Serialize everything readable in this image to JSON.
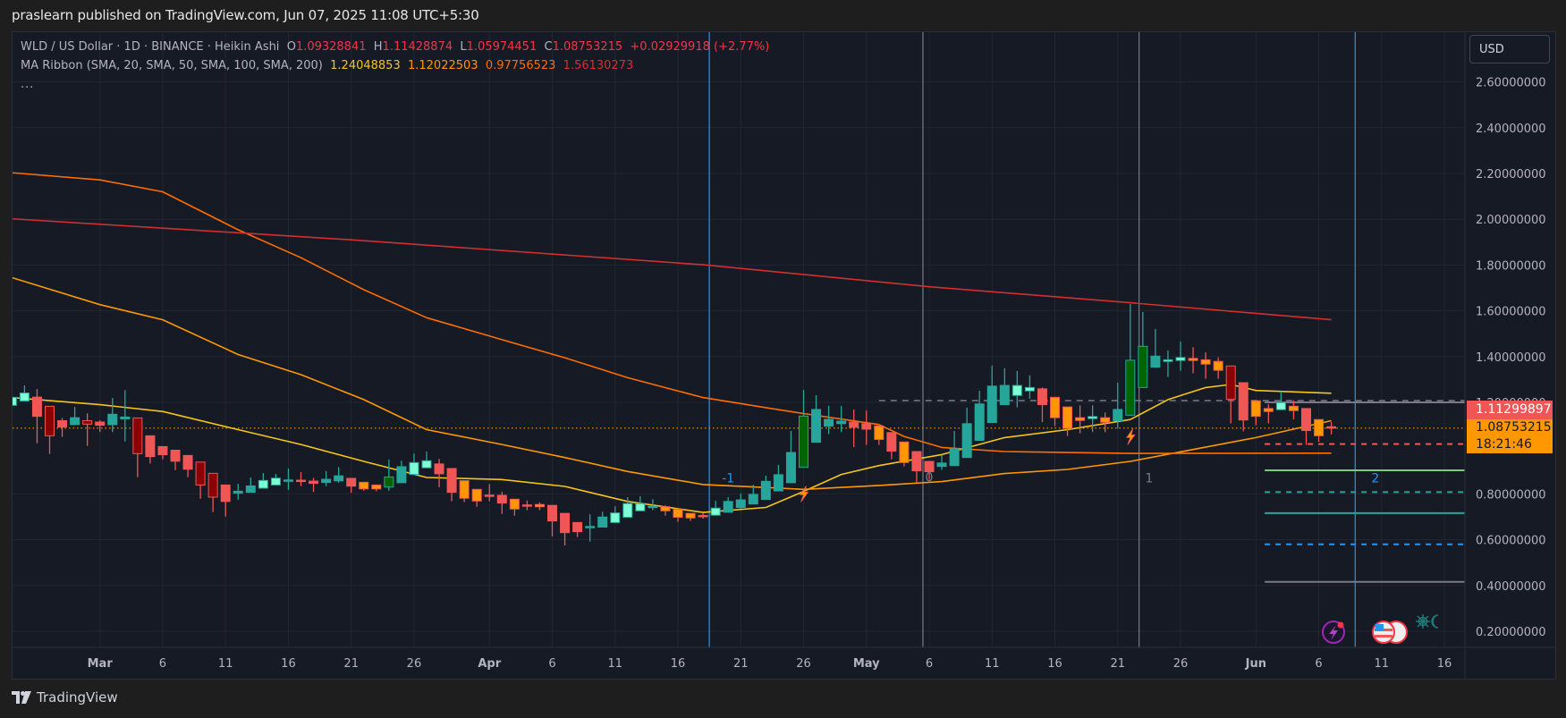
{
  "publish_line": "praslearn published on TradingView.com, Jun 07, 2025 11:08 UTC+5:30",
  "legend": {
    "symbol": "WLD / US Dollar · 1D · BINANCE · Heikin Ashi",
    "o_label": "O",
    "o": "1.09328841",
    "h_label": "H",
    "h": "1.11428874",
    "l_label": "L",
    "l": "1.05974451",
    "c_label": "C",
    "c": "1.08753215",
    "change": "+0.02929918 (+2.77%)",
    "ma_title": "MA Ribbon (SMA, 20, SMA, 50, SMA, 100, SMA, 200)",
    "ma20": "1.24048853",
    "ma50": "1.12022503",
    "ma100": "0.97756523",
    "ma200": "1.56130273",
    "more": "..."
  },
  "currency_button": "USD",
  "badges": {
    "level_price": "1.11299897",
    "last_price": "1.08753215",
    "countdown": "18:21:46"
  },
  "colors": {
    "bg": "#161a25",
    "grid": "#232632",
    "teal": "#26a69a",
    "mint": "#7fffd4",
    "green": "#006400",
    "red": "#f05656",
    "darkred": "#8b0000",
    "orange": "#ff9800",
    "ma20": "#f5c518",
    "ma50": "#ff9800",
    "ma100": "#ff6d00",
    "ma200": "#d32f2f"
  },
  "footer_brand": "TradingView",
  "chart_data": {
    "type": "candlestick",
    "style": "Heikin Ashi",
    "x_unit": "days since Mar 1, 2025",
    "ylim": [
      0.1,
      2.75
    ],
    "price_ticks": [
      "2.60000000",
      "2.40000000",
      "2.20000000",
      "2.00000000",
      "1.80000000",
      "1.60000000",
      "1.40000000",
      "1.20000000",
      "0.80000000",
      "0.60000000",
      "0.40000000",
      "0.20000000"
    ],
    "price_tick_values": [
      2.6,
      2.4,
      2.2,
      2.0,
      1.8,
      1.6,
      1.4,
      1.2,
      0.8,
      0.6,
      0.4,
      0.2
    ],
    "time_ticks": [
      {
        "label": "Mar",
        "day": 0,
        "bold": true
      },
      {
        "label": "6",
        "day": 5
      },
      {
        "label": "11",
        "day": 10
      },
      {
        "label": "16",
        "day": 15
      },
      {
        "label": "21",
        "day": 20
      },
      {
        "label": "26",
        "day": 25
      },
      {
        "label": "Apr",
        "day": 31,
        "bold": true
      },
      {
        "label": "6",
        "day": 36
      },
      {
        "label": "11",
        "day": 41
      },
      {
        "label": "16",
        "day": 46
      },
      {
        "label": "21",
        "day": 51
      },
      {
        "label": "26",
        "day": 56
      },
      {
        "label": "May",
        "day": 61,
        "bold": true
      },
      {
        "label": "6",
        "day": 66
      },
      {
        "label": "11",
        "day": 71
      },
      {
        "label": "16",
        "day": 76
      },
      {
        "label": "21",
        "day": 81
      },
      {
        "label": "26",
        "day": 86
      },
      {
        "label": "Jun",
        "day": 92,
        "bold": true
      },
      {
        "label": "6",
        "day": 97
      },
      {
        "label": "11",
        "day": 102
      },
      {
        "label": "16",
        "day": 107
      }
    ],
    "first_day": -7,
    "candles_ohlc_color": [
      [
        1.187,
        1.284,
        1.17,
        1.222,
        "m"
      ],
      [
        1.206,
        1.274,
        1.206,
        1.241,
        "m"
      ],
      [
        1.223,
        1.258,
        1.021,
        1.139,
        "r"
      ],
      [
        1.183,
        1.183,
        0.975,
        1.054,
        "d"
      ],
      [
        1.12,
        1.132,
        1.049,
        1.092,
        "r"
      ],
      [
        1.103,
        1.18,
        1.1,
        1.133,
        "t"
      ],
      [
        1.12,
        1.152,
        1.01,
        1.105,
        "d"
      ],
      [
        1.114,
        1.122,
        1.07,
        1.1,
        "r"
      ],
      [
        1.103,
        1.219,
        1.07,
        1.148,
        "t"
      ],
      [
        1.128,
        1.254,
        1.029,
        1.136,
        "t"
      ],
      [
        1.132,
        1.132,
        0.873,
        0.976,
        "d"
      ],
      [
        1.054,
        1.054,
        0.933,
        0.963,
        "r"
      ],
      [
        1.007,
        1.007,
        0.951,
        0.971,
        "r"
      ],
      [
        0.991,
        0.991,
        0.904,
        0.943,
        "r"
      ],
      [
        0.968,
        0.968,
        0.873,
        0.908,
        "r"
      ],
      [
        0.939,
        0.939,
        0.779,
        0.839,
        "d"
      ],
      [
        0.89,
        0.89,
        0.721,
        0.786,
        "d"
      ],
      [
        0.839,
        0.839,
        0.701,
        0.767,
        "r"
      ],
      [
        0.803,
        0.844,
        0.775,
        0.812,
        "t"
      ],
      [
        0.807,
        0.872,
        0.807,
        0.835,
        "t"
      ],
      [
        0.825,
        0.891,
        0.825,
        0.859,
        "m"
      ],
      [
        0.839,
        0.887,
        0.839,
        0.869,
        "m"
      ],
      [
        0.858,
        0.911,
        0.818,
        0.861,
        "t"
      ],
      [
        0.86,
        0.895,
        0.834,
        0.857,
        "r"
      ],
      [
        0.856,
        0.87,
        0.809,
        0.846,
        "r"
      ],
      [
        0.85,
        0.9,
        0.834,
        0.864,
        "t"
      ],
      [
        0.857,
        0.917,
        0.849,
        0.879,
        "t"
      ],
      [
        0.868,
        0.87,
        0.805,
        0.834,
        "r"
      ],
      [
        0.851,
        0.851,
        0.814,
        0.822,
        "o"
      ],
      [
        0.839,
        0.839,
        0.812,
        0.822,
        "o"
      ],
      [
        0.83,
        0.95,
        0.814,
        0.874,
        "g"
      ],
      [
        0.849,
        0.945,
        0.849,
        0.919,
        "t"
      ],
      [
        0.885,
        0.976,
        0.885,
        0.937,
        "m"
      ],
      [
        0.914,
        0.985,
        0.914,
        0.945,
        "m"
      ],
      [
        0.931,
        0.953,
        0.829,
        0.888,
        "r"
      ],
      [
        0.911,
        0.911,
        0.768,
        0.807,
        "r"
      ],
      [
        0.858,
        0.858,
        0.764,
        0.781,
        "o"
      ],
      [
        0.82,
        0.82,
        0.744,
        0.769,
        "o"
      ],
      [
        0.795,
        0.843,
        0.768,
        0.793,
        "r"
      ],
      [
        0.794,
        0.81,
        0.713,
        0.76,
        "r"
      ],
      [
        0.777,
        0.777,
        0.705,
        0.734,
        "o"
      ],
      [
        0.752,
        0.771,
        0.729,
        0.749,
        "r"
      ],
      [
        0.754,
        0.763,
        0.729,
        0.744,
        "o"
      ],
      [
        0.75,
        0.75,
        0.614,
        0.682,
        "r"
      ],
      [
        0.715,
        0.715,
        0.575,
        0.631,
        "r"
      ],
      [
        0.675,
        0.675,
        0.612,
        0.635,
        "r"
      ],
      [
        0.655,
        0.711,
        0.592,
        0.658,
        "t"
      ],
      [
        0.655,
        0.722,
        0.655,
        0.699,
        "t"
      ],
      [
        0.675,
        0.746,
        0.675,
        0.717,
        "m"
      ],
      [
        0.698,
        0.786,
        0.698,
        0.758,
        "m"
      ],
      [
        0.726,
        0.79,
        0.726,
        0.758,
        "m"
      ],
      [
        0.745,
        0.777,
        0.729,
        0.746,
        "t"
      ],
      [
        0.744,
        0.75,
        0.705,
        0.726,
        "o"
      ],
      [
        0.734,
        0.734,
        0.678,
        0.698,
        "o"
      ],
      [
        0.715,
        0.715,
        0.682,
        0.695,
        "o"
      ],
      [
        0.706,
        0.718,
        0.692,
        0.705,
        "r"
      ],
      [
        0.707,
        0.77,
        0.707,
        0.738,
        "m"
      ],
      [
        0.72,
        0.786,
        0.72,
        0.767,
        "t"
      ],
      [
        0.741,
        0.802,
        0.735,
        0.774,
        "t"
      ],
      [
        0.756,
        0.84,
        0.756,
        0.798,
        "t"
      ],
      [
        0.776,
        0.88,
        0.776,
        0.855,
        "t"
      ],
      [
        0.813,
        0.927,
        0.813,
        0.884,
        "t"
      ],
      [
        0.849,
        1.075,
        0.849,
        0.981,
        "t"
      ],
      [
        0.916,
        1.255,
        0.916,
        1.14,
        "g"
      ],
      [
        1.026,
        1.232,
        1.026,
        1.169,
        "t"
      ],
      [
        1.096,
        1.185,
        1.061,
        1.126,
        "t"
      ],
      [
        1.107,
        1.185,
        1.07,
        1.118,
        "t"
      ],
      [
        1.114,
        1.169,
        1.005,
        1.091,
        "r"
      ],
      [
        1.107,
        1.165,
        1.014,
        1.083,
        "r"
      ],
      [
        1.097,
        1.097,
        1.014,
        1.038,
        "o"
      ],
      [
        1.068,
        1.068,
        0.952,
        0.987,
        "r"
      ],
      [
        1.027,
        1.027,
        0.92,
        0.937,
        "o"
      ],
      [
        0.985,
        0.985,
        0.849,
        0.901,
        "r"
      ],
      [
        0.942,
        0.942,
        0.862,
        0.897,
        "r"
      ],
      [
        0.92,
        0.97,
        0.905,
        0.935,
        "t"
      ],
      [
        0.924,
        1.075,
        0.924,
        0.997,
        "t"
      ],
      [
        0.959,
        1.177,
        0.959,
        1.107,
        "t"
      ],
      [
        1.034,
        1.251,
        1.034,
        1.193,
        "t"
      ],
      [
        1.112,
        1.36,
        1.112,
        1.271,
        "t"
      ],
      [
        1.19,
        1.349,
        1.19,
        1.274,
        "t"
      ],
      [
        1.23,
        1.337,
        1.178,
        1.274,
        "m"
      ],
      [
        1.25,
        1.318,
        1.216,
        1.265,
        "m"
      ],
      [
        1.259,
        1.265,
        1.114,
        1.19,
        "r"
      ],
      [
        1.222,
        1.222,
        1.096,
        1.133,
        "o"
      ],
      [
        1.18,
        1.18,
        1.053,
        1.086,
        "o"
      ],
      [
        1.133,
        1.187,
        1.065,
        1.121,
        "o"
      ],
      [
        1.129,
        1.187,
        1.07,
        1.138,
        "m"
      ],
      [
        1.133,
        1.156,
        1.07,
        1.113,
        "o"
      ],
      [
        1.12,
        1.286,
        1.086,
        1.169,
        "t"
      ],
      [
        1.144,
        1.63,
        1.144,
        1.384,
        "g"
      ],
      [
        1.265,
        1.595,
        1.265,
        1.445,
        "g"
      ],
      [
        1.354,
        1.521,
        1.35,
        1.402,
        "t"
      ],
      [
        1.379,
        1.427,
        1.311,
        1.386,
        "m"
      ],
      [
        1.383,
        1.466,
        1.338,
        1.396,
        "m"
      ],
      [
        1.392,
        1.441,
        1.327,
        1.383,
        "o"
      ],
      [
        1.386,
        1.418,
        1.303,
        1.367,
        "o"
      ],
      [
        1.379,
        1.396,
        1.303,
        1.34,
        "o"
      ],
      [
        1.359,
        1.359,
        1.108,
        1.213,
        "d"
      ],
      [
        1.286,
        1.286,
        1.073,
        1.123,
        "r"
      ],
      [
        1.207,
        1.207,
        1.1,
        1.139,
        "o"
      ],
      [
        1.173,
        1.192,
        1.108,
        1.16,
        "o"
      ],
      [
        1.168,
        1.248,
        1.168,
        1.199,
        "m"
      ],
      [
        1.183,
        1.209,
        1.126,
        1.164,
        "o"
      ],
      [
        1.173,
        1.173,
        1.014,
        1.077,
        "r"
      ],
      [
        1.125,
        1.125,
        1.028,
        1.054,
        "o"
      ],
      [
        1.0933,
        1.1143,
        1.0597,
        1.0875,
        "r"
      ]
    ],
    "moving_averages": [
      {
        "name": "SMA 20",
        "color": "#f5c518",
        "points": [
          [
            -7,
            1.221
          ],
          [
            0,
            1.19
          ],
          [
            5,
            1.16
          ],
          [
            11,
            1.081
          ],
          [
            16,
            1.016
          ],
          [
            21,
            0.942
          ],
          [
            26,
            0.872
          ],
          [
            32,
            0.863
          ],
          [
            37,
            0.833
          ],
          [
            42,
            0.767
          ],
          [
            48,
            0.719
          ],
          [
            53,
            0.741
          ],
          [
            56,
            0.811
          ],
          [
            59,
            0.885
          ],
          [
            62,
            0.924
          ],
          [
            67,
            0.972
          ],
          [
            72,
            1.046
          ],
          [
            77,
            1.081
          ],
          [
            82,
            1.125
          ],
          [
            85,
            1.212
          ],
          [
            88,
            1.265
          ],
          [
            90,
            1.278
          ],
          [
            92,
            1.252
          ],
          [
            98,
            1.24
          ]
        ]
      },
      {
        "name": "SMA 50",
        "color": "#ff9800",
        "points": [
          [
            -7,
            1.745
          ],
          [
            0,
            1.627
          ],
          [
            5,
            1.561
          ],
          [
            11,
            1.409
          ],
          [
            16,
            1.321
          ],
          [
            21,
            1.212
          ],
          [
            26,
            1.081
          ],
          [
            32,
            1.016
          ],
          [
            37,
            0.959
          ],
          [
            42,
            0.898
          ],
          [
            48,
            0.841
          ],
          [
            53,
            0.828
          ],
          [
            56,
            0.82
          ],
          [
            62,
            0.837
          ],
          [
            67,
            0.854
          ],
          [
            72,
            0.889
          ],
          [
            77,
            0.907
          ],
          [
            82,
            0.942
          ],
          [
            87,
            0.994
          ],
          [
            92,
            1.046
          ],
          [
            98,
            1.12
          ]
        ]
      },
      {
        "name": "SMA 100",
        "color": "#ff6d00",
        "points": [
          [
            -7,
            2.203
          ],
          [
            0,
            2.172
          ],
          [
            5,
            2.12
          ],
          [
            11,
            1.954
          ],
          [
            16,
            1.832
          ],
          [
            21,
            1.692
          ],
          [
            26,
            1.57
          ],
          [
            32,
            1.474
          ],
          [
            37,
            1.395
          ],
          [
            42,
            1.308
          ],
          [
            48,
            1.221
          ],
          [
            53,
            1.177
          ],
          [
            56,
            1.151
          ],
          [
            62,
            1.103
          ],
          [
            64,
            1.051
          ],
          [
            67,
            1.003
          ],
          [
            72,
            0.985
          ],
          [
            82,
            0.977
          ],
          [
            98,
            0.978
          ]
        ]
      },
      {
        "name": "SMA 200",
        "color": "#d32f2f",
        "points": [
          [
            -7,
            2.002
          ],
          [
            20,
            1.91
          ],
          [
            48,
            1.801
          ],
          [
            66,
            1.705
          ],
          [
            82,
            1.635
          ],
          [
            98,
            1.561
          ]
        ]
      }
    ],
    "last_price": 1.08753215,
    "dashed_level": {
      "price": 1.208,
      "from_day": 62
    },
    "levels": [
      {
        "price": 1.2,
        "color": "#787b86",
        "style": "solid"
      },
      {
        "price": 1.018,
        "color": "#f05656",
        "style": "dashed"
      },
      {
        "price": 0.903,
        "color": "#81c784",
        "style": "solid"
      },
      {
        "price": 0.808,
        "color": "#26a69a",
        "style": "dashed"
      },
      {
        "price": 0.716,
        "color": "#26a69a",
        "style": "solid"
      },
      {
        "price": 0.58,
        "color": "#2196f3",
        "style": "dashed"
      },
      {
        "price": 0.416,
        "color": "#787b86",
        "style": "solid"
      }
    ],
    "levels_from_day": 92.7,
    "vertical_lines": [
      {
        "day": 48.5,
        "color": "#2196f3"
      },
      {
        "day": 65.5,
        "color": "#787b86"
      },
      {
        "day": 82.7,
        "color": "#787b86"
      },
      {
        "day": 99.9,
        "color": "#2196f3"
      }
    ],
    "cycle_labels": [
      {
        "text": "-1",
        "day": 50,
        "price": 0.85,
        "color": "#2196f3"
      },
      {
        "text": "0",
        "day": 66,
        "price": 0.855,
        "color": "#787b86"
      },
      {
        "text": "1",
        "day": 83.5,
        "price": 0.85,
        "color": "#787b86"
      },
      {
        "text": "2",
        "day": 101.5,
        "price": 0.85,
        "color": "#2196f3"
      }
    ],
    "event_markers": [
      {
        "day": 56,
        "price": 0.8
      },
      {
        "day": 82,
        "price": 1.05
      }
    ]
  }
}
